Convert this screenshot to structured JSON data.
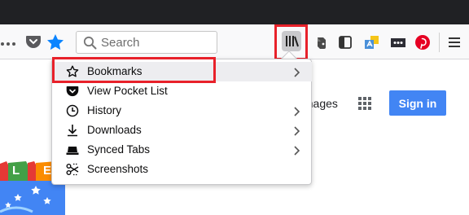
{
  "toolbar": {
    "search_placeholder": "Search",
    "icons": [
      "overflow-dots-icon",
      "pocket-icon",
      "bookmark-star-icon",
      "search-icon",
      "library-icon",
      "evernote-icon",
      "sidebar-icon",
      "translate-icon",
      "extension-icon",
      "pinterest-icon",
      "hamburger-menu-icon"
    ]
  },
  "page": {
    "images_label": "Images",
    "signin_label": "Sign in",
    "doodle_letters": [
      "L",
      "E"
    ]
  },
  "library_menu": {
    "items": [
      {
        "label": "Bookmarks",
        "icon": "star-outline-icon",
        "submenu": true
      },
      {
        "label": "View Pocket List",
        "icon": "pocket-icon",
        "submenu": false
      },
      {
        "label": "History",
        "icon": "clock-icon",
        "submenu": true
      },
      {
        "label": "Downloads",
        "icon": "download-arrow-icon",
        "submenu": true
      },
      {
        "label": "Synced Tabs",
        "icon": "synced-tabs-icon",
        "submenu": true
      },
      {
        "label": "Screenshots",
        "icon": "scissors-icon",
        "submenu": false
      }
    ]
  },
  "colors": {
    "highlight_frame": "#e8212a",
    "accent_blue": "#0a84ff",
    "signin_blue": "#4285f4",
    "pinterest_red": "#e60023"
  }
}
